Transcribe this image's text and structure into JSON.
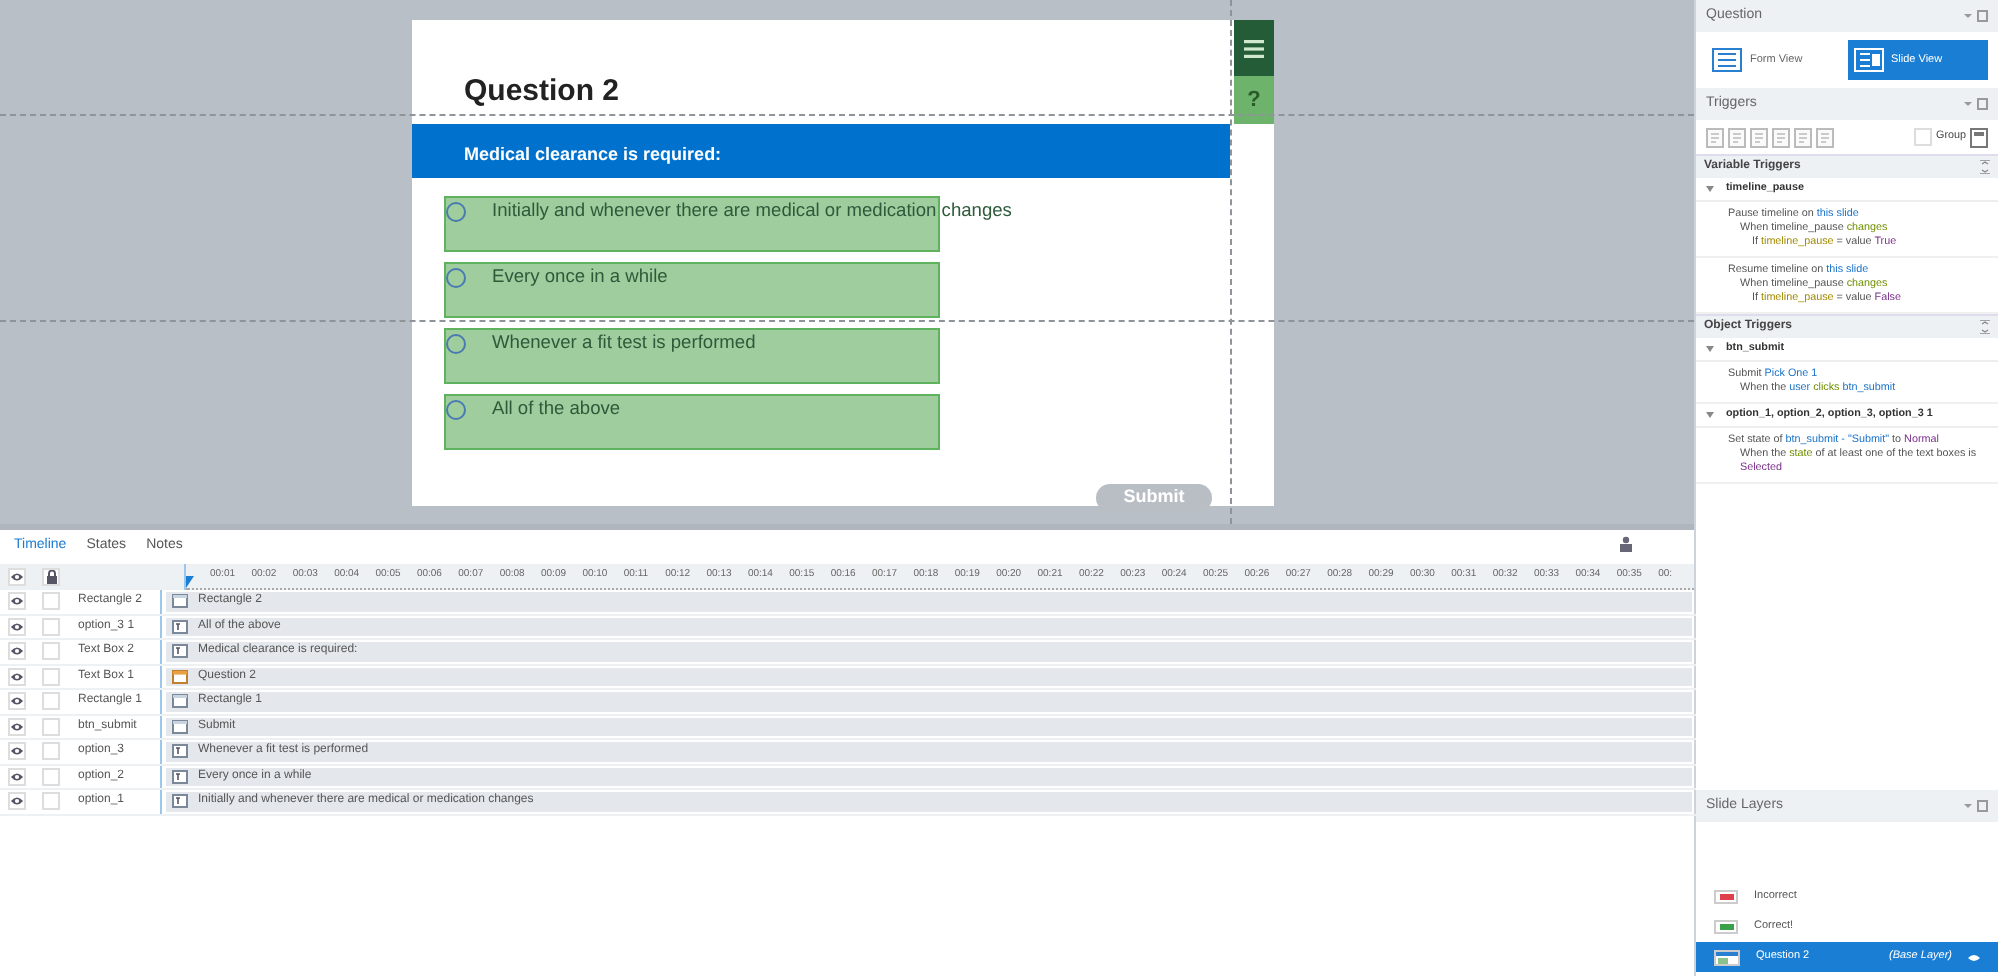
{
  "slide": {
    "title": "Question 2",
    "banner": "Medical clearance is required:",
    "options": [
      {
        "label": "Initially and whenever there are medical or medication changes",
        "selected": false
      },
      {
        "label": "Every once in a while",
        "selected": false
      },
      {
        "label": "Whenever a fit test is performed",
        "selected": false
      },
      {
        "label": "All of the above",
        "selected": false
      }
    ],
    "submit": {
      "label": "Submit",
      "disabled": true
    },
    "side_buttons": [
      {
        "kind": "menu"
      },
      {
        "kind": "help",
        "label": "?"
      }
    ]
  },
  "timeline": {
    "tabs": [
      {
        "label": "Timeline",
        "selected": true
      },
      {
        "label": "States",
        "selected": false
      },
      {
        "label": "Notes",
        "selected": false
      }
    ],
    "ticks": [
      "00:01",
      "00:02",
      "00:03",
      "00:04",
      "00:05",
      "00:06",
      "00:07",
      "00:08",
      "00:09",
      "00:10",
      "00:11",
      "00:12",
      "00:13",
      "00:14",
      "00:15",
      "00:16",
      "00:17",
      "00:18",
      "00:19",
      "00:20",
      "00:21",
      "00:22",
      "00:23",
      "00:24",
      "00:25",
      "00:26",
      "00:27",
      "00:28",
      "00:29",
      "00:30",
      "00:31",
      "00:32",
      "00:33",
      "00:34",
      "00:35",
      "00:"
    ],
    "layers": [
      {
        "name": "Rectangle 2",
        "object": "Rectangle 2",
        "kind": "shape",
        "locked": false
      },
      {
        "name": "option_3 1",
        "object": "All of the above",
        "kind": "text",
        "locked": false
      },
      {
        "name": "Text Box 2",
        "object": "Medical clearance is required:",
        "kind": "text",
        "locked": false
      },
      {
        "name": "Text Box 1",
        "object": "Question 2",
        "kind": "title",
        "locked": false
      },
      {
        "name": "Rectangle 1",
        "object": "Rectangle 1",
        "kind": "shape",
        "locked": false
      },
      {
        "name": "btn_submit",
        "object": "Submit",
        "kind": "shape",
        "locked": false
      },
      {
        "name": "option_3",
        "object": "Whenever a fit test is performed",
        "kind": "text",
        "locked": false
      },
      {
        "name": "option_2",
        "object": "Every once in a while",
        "kind": "text",
        "locked": false
      },
      {
        "name": "option_1",
        "object": "Initially and whenever there are medical or medication changes",
        "kind": "text",
        "locked": false
      }
    ]
  },
  "question_panel": {
    "title": "Question",
    "views": [
      {
        "label": "Form View",
        "kind": "form",
        "selected": false
      },
      {
        "label": "Slide View",
        "kind": "slide",
        "selected": true
      }
    ]
  },
  "triggers_panel": {
    "title": "Triggers",
    "group_label": "Group",
    "group_checked": false,
    "sections": [
      {
        "title": "Variable Triggers",
        "groups": [
          {
            "name": "timeline_pause",
            "triggers": [
              [
                [
                  {
                    "t": "Pause timeline on "
                  },
                  {
                    "t": "this slide",
                    "kind": "object"
                  }
                ],
                [
                  {
                    "t": "When timeline_pause "
                  },
                  {
                    "t": "changes",
                    "kind": "event"
                  }
                ],
                [
                  {
                    "t": "If "
                  },
                  {
                    "t": "timeline_pause",
                    "kind": "variable"
                  },
                  {
                    "t": " = value "
                  },
                  {
                    "t": "True",
                    "kind": "value"
                  }
                ]
              ],
              [
                [
                  {
                    "t": "Resume timeline on "
                  },
                  {
                    "t": "this slide",
                    "kind": "object"
                  }
                ],
                [
                  {
                    "t": "When timeline_pause "
                  },
                  {
                    "t": "changes",
                    "kind": "event"
                  }
                ],
                [
                  {
                    "t": "If "
                  },
                  {
                    "t": "timeline_pause",
                    "kind": "variable"
                  },
                  {
                    "t": " = value "
                  },
                  {
                    "t": "False",
                    "kind": "value"
                  }
                ]
              ]
            ]
          }
        ]
      },
      {
        "title": "Object Triggers",
        "groups": [
          {
            "name": "btn_submit",
            "triggers": [
              [
                [
                  {
                    "t": "Submit "
                  },
                  {
                    "t": "Pick One 1",
                    "kind": "object"
                  }
                ],
                [
                  {
                    "t": "When the "
                  },
                  {
                    "t": "user ",
                    "kind": "object"
                  },
                  {
                    "t": "clicks ",
                    "kind": "event"
                  },
                  {
                    "t": "btn_submit",
                    "kind": "object"
                  }
                ]
              ]
            ]
          },
          {
            "name": "option_1, option_2, option_3, option_3 1",
            "triggers": [
              [
                [
                  {
                    "t": "Set state of "
                  },
                  {
                    "t": "btn_submit - \"Submit\"",
                    "kind": "object"
                  },
                  {
                    "t": " to "
                  },
                  {
                    "t": "Normal",
                    "kind": "value"
                  }
                ],
                [
                  {
                    "t": "When the "
                  },
                  {
                    "t": "state",
                    "kind": "event"
                  },
                  {
                    "t": " of at least one of the text boxes is "
                  },
                  {
                    "t": "Selected",
                    "kind": "value"
                  }
                ]
              ]
            ]
          }
        ]
      }
    ]
  },
  "layers_panel": {
    "title": "Slide Layers",
    "layers": [
      {
        "name": "Incorrect",
        "color": "#e0404c",
        "selected": false
      },
      {
        "name": "Correct!",
        "color": "#3aa04a",
        "selected": false
      },
      {
        "name": "Question 2",
        "base_label": "(Base Layer)",
        "selected": true
      }
    ]
  }
}
